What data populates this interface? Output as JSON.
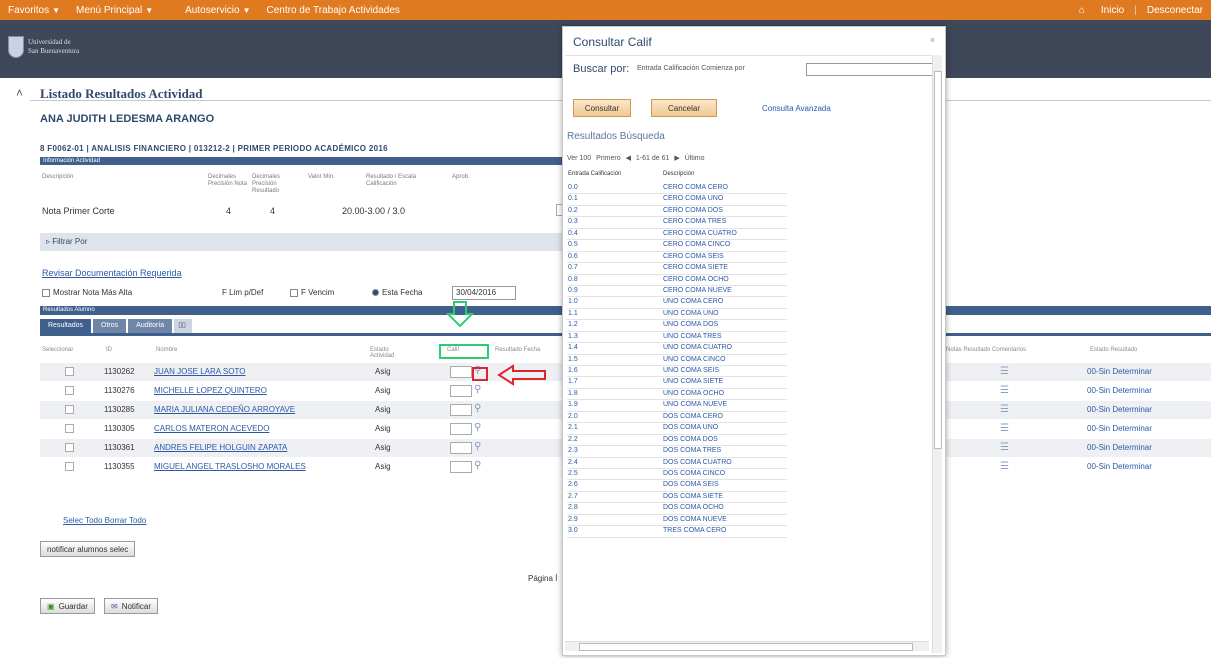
{
  "topnav": {
    "items": [
      {
        "label": "Favoritos",
        "caret": "▼"
      },
      {
        "label": "Menú Principal",
        "caret": "▼"
      },
      {
        "label": "Autoservicio",
        "caret": "▼"
      },
      {
        "label": "Centro de Trabajo Actividades",
        "caret": ""
      }
    ],
    "home_icon": "home-icon",
    "inicio": "Inicio",
    "desconectar": "Desconectar"
  },
  "logo": {
    "line1": "Universidad de",
    "line2": "San Buenaventura"
  },
  "page": {
    "title": "Listado Resultados Actividad",
    "student": "ANA JUDITH LEDESMA ARANGO",
    "course_line": "8 F0062-01 | ANALISIS FINANCIERO | 013212-2 | PRIMER PERIODO ACADÉMICO 2016"
  },
  "info": {
    "bar_label": "Información Actividad",
    "headers": [
      "Descripción",
      "Decimales Precisión Nota",
      "Decimales Precisión Resultado",
      "Valor Mín.",
      "Resultado / Escala Calificación",
      "Aprob."
    ],
    "row": {
      "desc": "Nota Primer Corte",
      "dec1": "4",
      "dec2": "4",
      "range": "20.00-3.00 / 3.0"
    }
  },
  "filter_label": "Filtrar Por",
  "revisar_link": "Revisar Documentación Requerida",
  "options": {
    "mostrar": "Mostrar Nota Más Alta",
    "fdef": "F Lim p/Def",
    "fvenc": "F Vencim",
    "estafecha": "Esta Fecha",
    "date": "30/04/2016"
  },
  "results": {
    "bar_label": "Resultados Alumno",
    "tabs": [
      "Resultados",
      "Otros",
      "Auditoría",
      "▯▯"
    ],
    "headers": [
      "Seleccionar",
      "ID",
      "Nombre",
      "Estado Actividad",
      "Calif",
      "Resultado Fecha"
    ],
    "right_headers": [
      "Notas Resultado Comentarios",
      "Estado Resultado"
    ],
    "rows": [
      {
        "id": "1130262",
        "name": "JUAN JOSE LARA SOTO",
        "type": "Asig",
        "status": "00-Sin Determinar"
      },
      {
        "id": "1130276",
        "name": "MICHELLE LOPEZ QUINTERO",
        "type": "Asig",
        "status": "00-Sin Determinar"
      },
      {
        "id": "1130285",
        "name": "MARIA JULIANA CEDEÑO ARROYAVE",
        "type": "Asig",
        "status": "00-Sin Determinar"
      },
      {
        "id": "1130305",
        "name": "CARLOS MATERON ACEVEDO",
        "type": "Asig",
        "status": "00-Sin Determinar"
      },
      {
        "id": "1130361",
        "name": "ANDRES FELIPE HOLGUIN ZAPATA",
        "type": "Asig",
        "status": "00-Sin Determinar"
      },
      {
        "id": "1130355",
        "name": "MIGUEL ANGEL TRASLOSHO MORALES",
        "type": "Asig",
        "status": "00-Sin Determinar"
      }
    ]
  },
  "select_all": "Selec Todo Borrar Todo",
  "notify_selected": "notificar alumnos selec",
  "page_label": "Página Í",
  "buttons": {
    "save": "Guardar",
    "notify": "Notificar"
  },
  "modal": {
    "title": "Consultar Calif",
    "search_label": "Buscar por:",
    "search_field": "Entrada Calificación Comienza por",
    "search_value": "",
    "consultar": "Consultar",
    "cancelar": "Cancelar",
    "avanzada": "Consulta Avanzada",
    "results_title": "Resultados Búsqueda",
    "pager": {
      "ver": "Ver 100",
      "primero": "Primero",
      "range": "1-61 de 61",
      "ultimo": "Último"
    },
    "headers": [
      "Entrada Calificación",
      "Descripción"
    ],
    "rows": [
      {
        "code": "0.0",
        "desc": "CERO COMA CERO"
      },
      {
        "code": "0.1",
        "desc": "CERO COMA UNO"
      },
      {
        "code": "0.2",
        "desc": "CERO COMA DOS"
      },
      {
        "code": "0.3",
        "desc": "CERO COMA TRES"
      },
      {
        "code": "0.4",
        "desc": "CERO COMA CUATRO"
      },
      {
        "code": "0.5",
        "desc": "CERO COMA CINCO"
      },
      {
        "code": "0.6",
        "desc": "CERO COMA SEIS"
      },
      {
        "code": "0.7",
        "desc": "CERO COMA SIETE"
      },
      {
        "code": "0.8",
        "desc": "CERO COMA OCHO"
      },
      {
        "code": "0.9",
        "desc": "CERO COMA NUEVE"
      },
      {
        "code": "1.0",
        "desc": "UNO COMA CERO"
      },
      {
        "code": "1.1",
        "desc": "UNO COMA UNO"
      },
      {
        "code": "1.2",
        "desc": "UNO COMA DOS"
      },
      {
        "code": "1.3",
        "desc": "UNO COMA TRES"
      },
      {
        "code": "1.4",
        "desc": "UNO COMA CUATRO"
      },
      {
        "code": "1.5",
        "desc": "UNO COMA CINCO"
      },
      {
        "code": "1.6",
        "desc": "UNO COMA SEIS"
      },
      {
        "code": "1.7",
        "desc": "UNO COMA SIETE"
      },
      {
        "code": "1.8",
        "desc": "UNO COMA OCHO"
      },
      {
        "code": "1.9",
        "desc": "UNO COMA NUEVE"
      },
      {
        "code": "2.0",
        "desc": "DOS COMA CERO"
      },
      {
        "code": "2.1",
        "desc": "DOS COMA UNO"
      },
      {
        "code": "2.2",
        "desc": "DOS COMA DOS"
      },
      {
        "code": "2.3",
        "desc": "DOS COMA TRES"
      },
      {
        "code": "2.4",
        "desc": "DOS COMA CUATRO"
      },
      {
        "code": "2.5",
        "desc": "DOS COMA CINCO"
      },
      {
        "code": "2.6",
        "desc": "DOS COMA SEIS"
      },
      {
        "code": "2.7",
        "desc": "DOS COMA SIETE"
      },
      {
        "code": "2.8",
        "desc": "DOS COMA OCHO"
      },
      {
        "code": "2.9",
        "desc": "DOS COMA NUEVE"
      },
      {
        "code": "3.0",
        "desc": "TRES COMA CERO"
      }
    ]
  },
  "colors": {
    "orange": "#e07a21",
    "dark": "#3e4859",
    "navy": "#3f5f8c",
    "green_highlight": "#2ecc71",
    "red_arrow": "#e0242f"
  }
}
